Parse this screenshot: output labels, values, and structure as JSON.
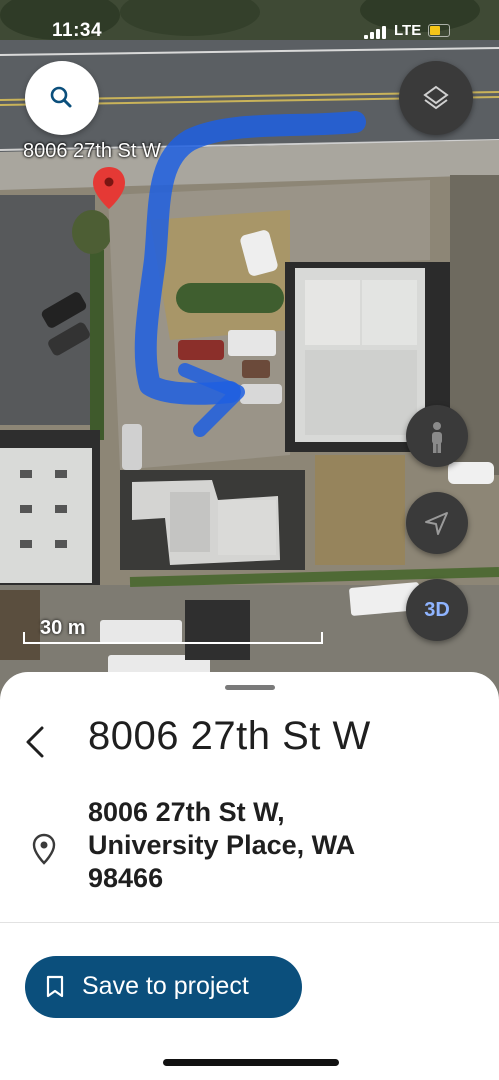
{
  "status_bar": {
    "time": "11:34",
    "network": "LTE"
  },
  "map": {
    "address_label": "8006 27th St W",
    "scale_label": "30 m",
    "three_d_label": "3D",
    "route_color": "#1f5fe0",
    "pin_color": "#e53935"
  },
  "place_sheet": {
    "title": "8006 27th St W",
    "full_address": "8006 27th St W,\nUniversity Place, WA\n98466",
    "save_button_label": "Save to project",
    "save_button_color": "#0b4f7c"
  }
}
